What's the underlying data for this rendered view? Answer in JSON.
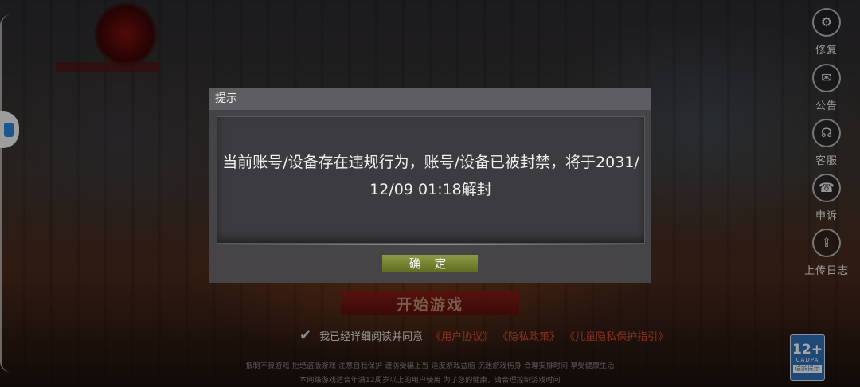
{
  "dialog": {
    "title": "提示",
    "message": "当前账号/设备存在违规行为，账号/设备已被封禁，将于2031/12/09 01:18解封",
    "confirm_label": "确 定"
  },
  "menu": [
    {
      "icon": "gear-icon",
      "label": "修复"
    },
    {
      "icon": "announcement-icon",
      "label": "公告"
    },
    {
      "icon": "headset-icon",
      "label": "客服"
    },
    {
      "icon": "appeal-icon",
      "label": "申诉"
    },
    {
      "icon": "upload-icon",
      "label": "上传日志"
    }
  ],
  "start_button_label": "开始游戏",
  "agreement": {
    "text": "我已经详细阅读并同意",
    "links": [
      "《用户协议》",
      "《隐私政策》",
      "《儿童隐私保护指引》"
    ]
  },
  "notice_lines": [
    "抵制不良游戏 拒绝盗版游戏 注意自我保护 谨防受骗上当 适度游戏益脑 沉迷游戏伤身 合理安排时间 享受健康生活",
    "本网络游戏适合年满12周岁以上的用户使用   为了您的健康，请合理控制游戏时间"
  ],
  "rating": {
    "age": "12+",
    "org": "CADPA",
    "tip": "适龄提示"
  },
  "colors": {
    "link": "#d04a30",
    "confirm": "#7a8830",
    "start": "#8b1a14"
  }
}
